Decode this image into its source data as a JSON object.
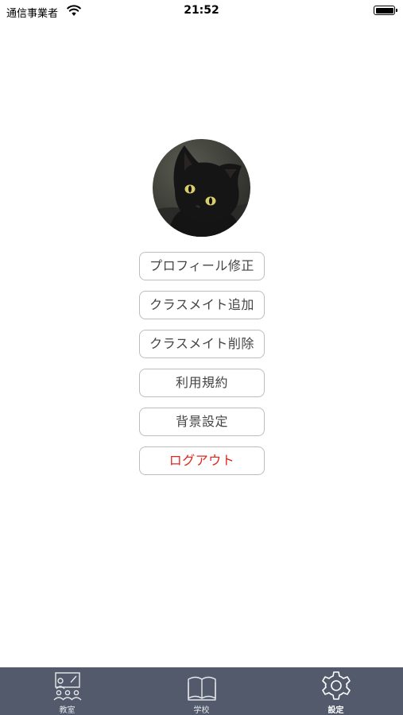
{
  "status_bar": {
    "carrier": "通信事業者",
    "time": "21:52"
  },
  "profile": {
    "avatar_icon": "cat-photo"
  },
  "menu": {
    "profile_edit": "プロフィール修正",
    "add_classmate": "クラスメイト追加",
    "delete_classmate": "クラスメイト削除",
    "terms": "利用規約",
    "background_settings": "背景設定",
    "logout": "ログアウト"
  },
  "tab_bar": {
    "tabs": [
      {
        "label": "教室",
        "icon": "classroom-icon"
      },
      {
        "label": "学校",
        "icon": "book-icon"
      },
      {
        "label": "設定",
        "icon": "gear-icon",
        "active": true
      }
    ]
  },
  "colors": {
    "tab_bar_bg": "#525a6b",
    "logout": "#e0261c",
    "button_border": "#bdbdbd"
  }
}
